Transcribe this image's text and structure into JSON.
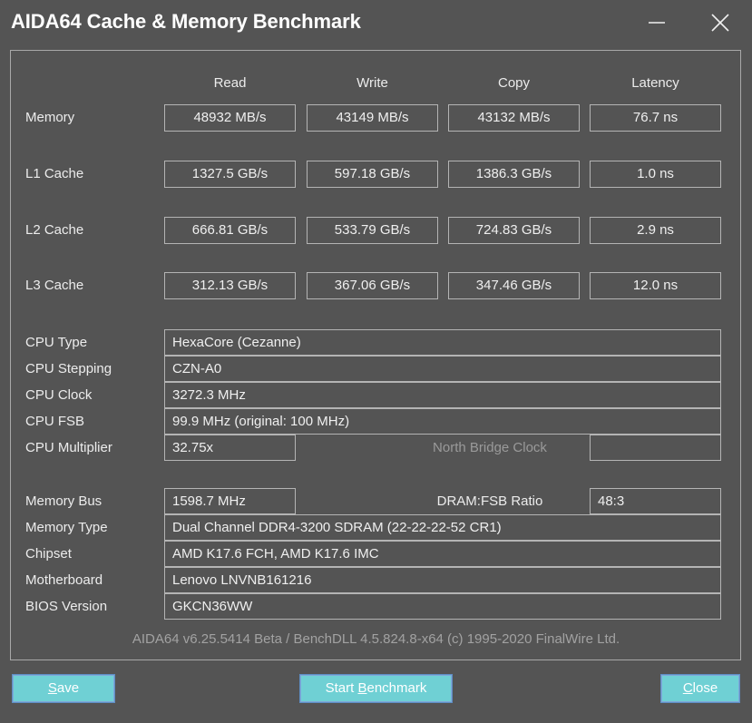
{
  "window": {
    "title": "AIDA64 Cache & Memory Benchmark",
    "minimize_icon": "minimize-icon",
    "close_icon": "close-icon"
  },
  "columns": {
    "read": "Read",
    "write": "Write",
    "copy": "Copy",
    "latency": "Latency"
  },
  "benchmark_rows": [
    {
      "label": "Memory",
      "read": "48932 MB/s",
      "write": "43149 MB/s",
      "copy": "43132 MB/s",
      "latency": "76.7 ns"
    },
    {
      "label": "L1 Cache",
      "read": "1327.5 GB/s",
      "write": "597.18 GB/s",
      "copy": "1386.3 GB/s",
      "latency": "1.0 ns"
    },
    {
      "label": "L2 Cache",
      "read": "666.81 GB/s",
      "write": "533.79 GB/s",
      "copy": "724.83 GB/s",
      "latency": "2.9 ns"
    },
    {
      "label": "L3 Cache",
      "read": "312.13 GB/s",
      "write": "367.06 GB/s",
      "copy": "347.46 GB/s",
      "latency": "12.0 ns"
    }
  ],
  "cpu_info": {
    "cpu_type_label": "CPU Type",
    "cpu_type_value": "HexaCore   (Cezanne)",
    "cpu_stepping_label": "CPU Stepping",
    "cpu_stepping_value": "CZN-A0",
    "cpu_clock_label": "CPU Clock",
    "cpu_clock_value": "3272.3 MHz",
    "cpu_fsb_label": "CPU FSB",
    "cpu_fsb_value": "99.9 MHz  (original: 100 MHz)",
    "cpu_multiplier_label": "CPU Multiplier",
    "cpu_multiplier_value": "32.75x",
    "north_bridge_clock_label": "North Bridge Clock",
    "north_bridge_clock_value": ""
  },
  "memory_info": {
    "memory_bus_label": "Memory Bus",
    "memory_bus_value": "1598.7 MHz",
    "dram_fsb_ratio_label": "DRAM:FSB Ratio",
    "dram_fsb_ratio_value": "48:3",
    "memory_type_label": "Memory Type",
    "memory_type_value": "Dual Channel DDR4-3200 SDRAM  (22-22-22-52 CR1)",
    "chipset_label": "Chipset",
    "chipset_value": "AMD K17.6 FCH, AMD K17.6 IMC",
    "motherboard_label": "Motherboard",
    "motherboard_value": "Lenovo LNVNB161216",
    "bios_version_label": "BIOS Version",
    "bios_version_value": "GKCN36WW"
  },
  "footer": {
    "version_text": "AIDA64 v6.25.5414 Beta / BenchDLL 4.5.824.8-x64  (c) 1995-2020 FinalWire Ltd."
  },
  "buttons": {
    "save": {
      "before": "",
      "accel": "S",
      "after": "ave"
    },
    "start_benchmark": {
      "before": "Start ",
      "accel": "B",
      "after": "enchmark"
    },
    "close": {
      "before": "",
      "accel": "C",
      "after": "lose"
    }
  },
  "colors": {
    "window_background": "#545454",
    "button_accent": "#6fd0d4",
    "button_border": "#7fa8d8",
    "field_border": "#b4b4b4",
    "text": "#ececec",
    "dim_text": "#9a9a9a"
  }
}
